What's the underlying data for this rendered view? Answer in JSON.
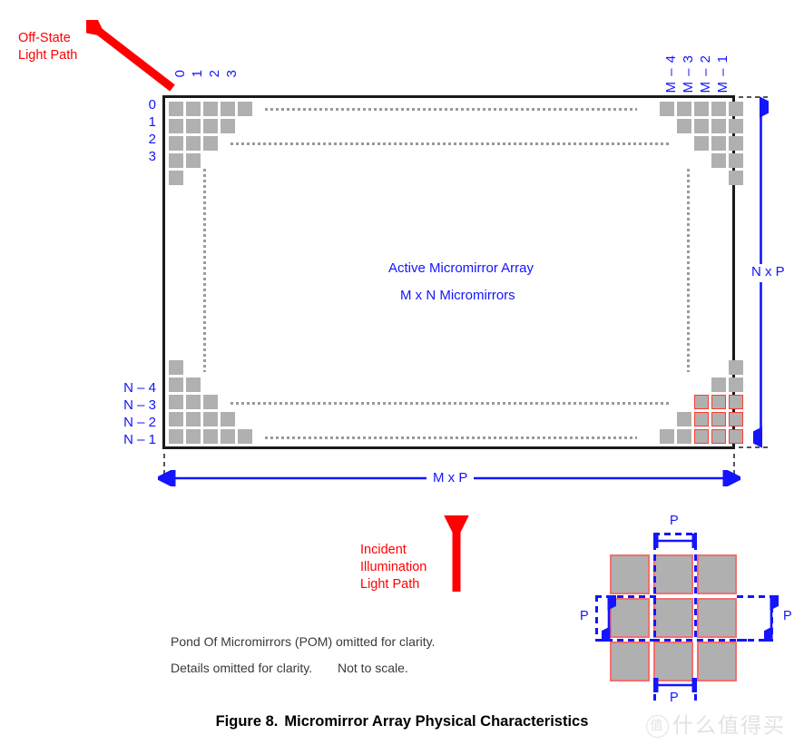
{
  "figure": {
    "caption_number": "Figure 8.",
    "caption_title": "Micromirror Array Physical Characteristics"
  },
  "labels": {
    "off_state_line1": "Off-State",
    "off_state_line2": "Light Path",
    "incident_line1": "Incident",
    "incident_line2": "Illumination",
    "incident_line3": "Light Path",
    "active_array": "Active Micromirror Array",
    "mxn_micromirrors": "M x N  Micromirrors",
    "dim_width": "M x P",
    "dim_height": "N x P"
  },
  "column_indices_left": [
    "0",
    "1",
    "2",
    "3"
  ],
  "column_indices_right": [
    "M – 4",
    "M – 3",
    "M – 2",
    "M – 1"
  ],
  "row_indices_top": [
    "0",
    "1",
    "2",
    "3"
  ],
  "row_indices_bottom": [
    "N – 4",
    "N – 3",
    "N – 2",
    "N – 1"
  ],
  "notes": {
    "note1": "Pond Of Micromirrors (POM) omitted for clarity.",
    "note2": "Details omitted for clarity.",
    "note3": "Not to scale."
  },
  "pitch_detail": {
    "label_top": "P",
    "label_left": "P",
    "label_right": "P",
    "label_bottom": "P"
  },
  "watermark": {
    "mark": "值",
    "text": "什么值得买"
  },
  "colors": {
    "mirror_fill": "#b0b0b0",
    "mirror_highlight_border": "#ff3b30",
    "annotation_blue": "#1414ff",
    "light_path_red": "#ff0000",
    "frame_black": "#1a1a1a",
    "ellipsis_gray": "#9a9a9a",
    "note_gray": "#3a3a3a"
  }
}
